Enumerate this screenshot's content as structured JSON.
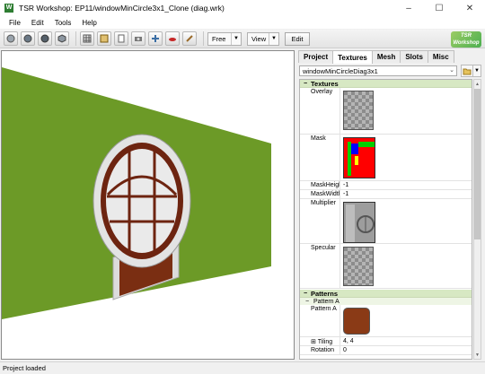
{
  "window": {
    "title": "TSR Workshop: EP11/windowMinCircle3x1_Clone (diag.wrk)",
    "minimize": "–",
    "maximize": "☐",
    "close": "✕"
  },
  "menu": [
    "File",
    "Edit",
    "Tools",
    "Help"
  ],
  "toolbar": {
    "mode_value": "Free",
    "view_value": "View",
    "edit_label": "Edit",
    "logo_line1": "TSR",
    "logo_line2": "Workshop"
  },
  "panel": {
    "tabs": [
      "Project",
      "Textures",
      "Mesh",
      "Slots",
      "Misc"
    ],
    "active_tab": "Textures",
    "object_select": "windowMinCircleDiag3x1",
    "categories": {
      "textures": "Textures",
      "patterns": "Patterns"
    },
    "properties": {
      "overlay": "Overlay",
      "mask": "Mask",
      "mask_height_label": "MaskHeight",
      "mask_height_value": "-1",
      "mask_width_label": "MaskWidth",
      "mask_width_value": "-1",
      "multiplier": "Multiplier",
      "specular": "Specular"
    },
    "pattern": {
      "subcat": "Pattern A",
      "label": "Pattern A",
      "tiling_label": "Tiling",
      "tiling_value": "4, 4",
      "rotation_label": "Rotation",
      "rotation_value": "0",
      "color_swatch": "#8a3a16"
    }
  },
  "status": {
    "text": "Project loaded"
  },
  "colors": {
    "floor_green": "#6c9a27",
    "category_bg": "#d7e8c3",
    "mask_red": "#ff0000",
    "mask_green": "#00e000",
    "mask_blue": "#0000ff"
  }
}
